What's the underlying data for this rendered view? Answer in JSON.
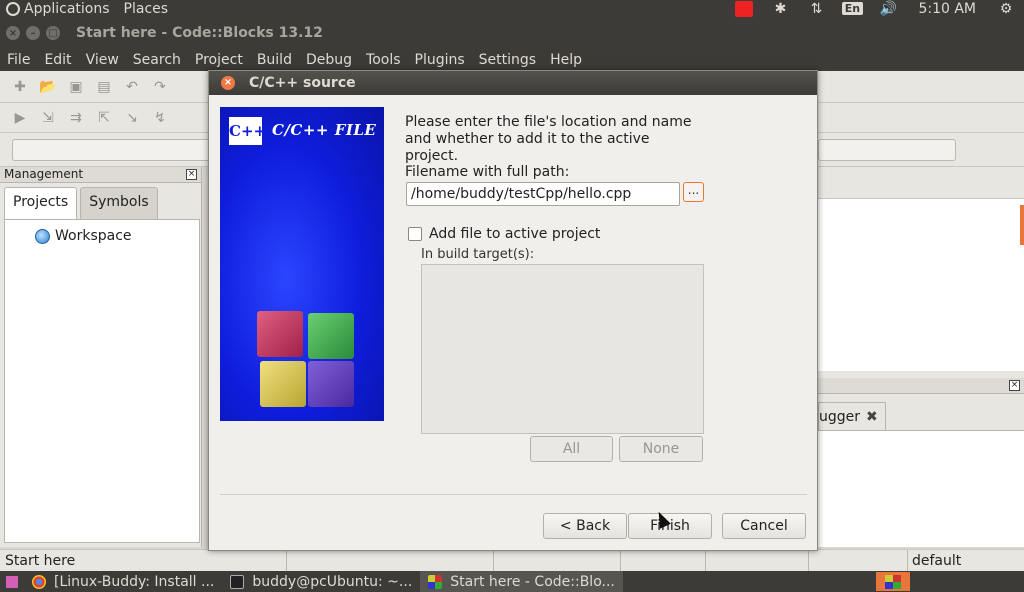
{
  "top_panel": {
    "applications": "Applications",
    "places": "Places",
    "lang": "En",
    "clock": "5:10 AM"
  },
  "window": {
    "title": "Start here - Code::Blocks 13.12"
  },
  "menubar": [
    "File",
    "Edit",
    "View",
    "Search",
    "Project",
    "Build",
    "Debug",
    "Tools",
    "Plugins",
    "Settings",
    "Help"
  ],
  "management": {
    "title": "Management",
    "tabs": [
      "Projects",
      "Symbols"
    ],
    "tree_root": "Workspace"
  },
  "right_panel": {
    "debugger_tab": "ugger"
  },
  "statusbar": {
    "left": "Start here",
    "right": "default"
  },
  "taskbar": {
    "tasks": [
      "[Linux-Buddy: Install ...",
      "buddy@pcUbuntu: ~...",
      "Start here - Code::Blo..."
    ]
  },
  "dialog": {
    "title": "C/C++ source",
    "banner_logo": "C++",
    "banner_text": "C/C++ FILE",
    "description": "Please enter the file's location and name and whether to add it to the active project.",
    "filename_label": "Filename with full path:",
    "filename_value": "/home/buddy/testCpp/hello.cpp",
    "browse_label": "...",
    "add_to_project_label": "Add file to active project",
    "add_to_project_checked": false,
    "build_targets_label": "In build target(s):",
    "all_label": "All",
    "none_label": "None",
    "back_label": "< Back",
    "finish_label": "Finish",
    "cancel_label": "Cancel"
  },
  "colors": {
    "panel_dark": "#3c3b37",
    "accent_orange": "#e8763a",
    "banner_blue": "#0e1ddb"
  }
}
